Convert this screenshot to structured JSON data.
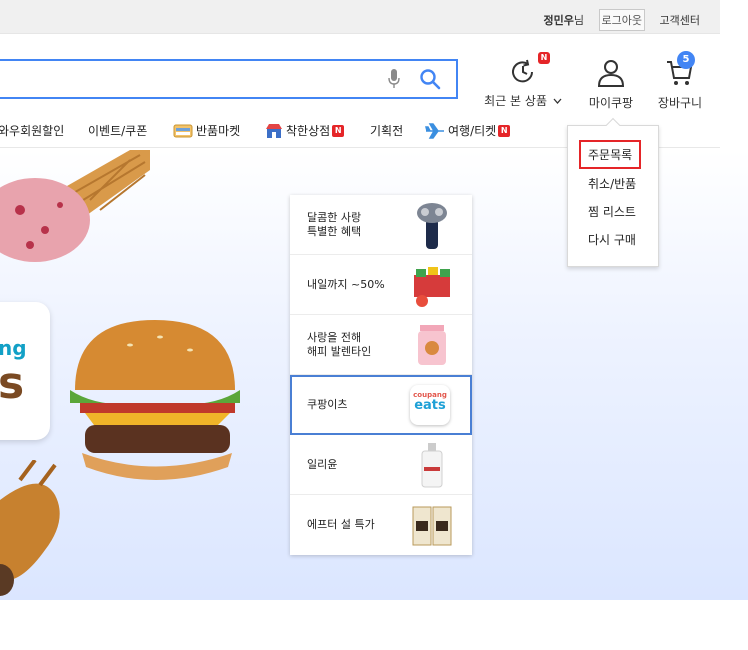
{
  "topbar": {
    "user_name": "정민우",
    "user_suffix": "님",
    "logout_label": "로그아웃",
    "customer_center_label": "고객센터"
  },
  "header": {
    "recent_label": "최근 본 상품",
    "recent_badge": "N",
    "mycoupang_label": "마이쿠팡",
    "cart_label": "장바구니",
    "cart_count": "5",
    "accent_color": "#4285f4"
  },
  "category_nav": {
    "items": [
      {
        "label": "와우회원할인"
      },
      {
        "label": "이벤트/쿠폰"
      },
      {
        "label": "반품마켓"
      },
      {
        "label": "착한상점",
        "badge": "N"
      },
      {
        "label": "기획전"
      },
      {
        "label": "여행/티켓",
        "badge": "N"
      }
    ]
  },
  "mycoupang_menu": {
    "items": [
      "주문목록",
      "취소/반품",
      "찜 리스트",
      "다시 구매"
    ]
  },
  "banner": {
    "fragment_text_1": "ng",
    "fragment_text_2": "s"
  },
  "promo_list": {
    "items": [
      {
        "label": "달콤한 사랑\n특별한 혜택",
        "icon": "shaver-icon"
      },
      {
        "label": "내일까지 ~50%",
        "icon": "snack-box-icon"
      },
      {
        "label": "사랑을 전해\n해피 발렌타인",
        "icon": "jar-icon"
      },
      {
        "label": "쿠팡이츠",
        "icon": "coupang-eats-logo",
        "logo_top": "coupang",
        "logo_bottom": "eats"
      },
      {
        "label": "일리윤",
        "icon": "lotion-bottle-icon"
      },
      {
        "label": "에프터 설 특가",
        "icon": "gift-box-icon"
      }
    ]
  }
}
